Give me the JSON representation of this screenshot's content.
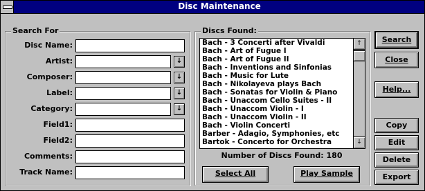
{
  "window": {
    "title": "Disc Maintenance"
  },
  "search_group": {
    "label": "Search For",
    "fields": [
      {
        "label": "Disc Name:",
        "value": "",
        "dropdown": false
      },
      {
        "label": "Artist:",
        "value": "",
        "dropdown": true
      },
      {
        "label": "Composer:",
        "value": "",
        "dropdown": true
      },
      {
        "label": "Label:",
        "value": "",
        "dropdown": true
      },
      {
        "label": "Category:",
        "value": "",
        "dropdown": true
      },
      {
        "label": "Field1:",
        "value": "",
        "dropdown": false
      },
      {
        "label": "Field2:",
        "value": "",
        "dropdown": false
      },
      {
        "label": "Comments:",
        "value": "",
        "dropdown": false
      },
      {
        "label": "Track Name:",
        "value": "",
        "dropdown": false
      }
    ]
  },
  "discs_group": {
    "label": "Discs Found:",
    "items": [
      "Bach - 3 Concerti after Vivaldi",
      "Bach - Art of Fugue I",
      "Bach - Art of Fugue II",
      "Bach - Inventions and Sinfonias",
      "Bach - Music for Lute",
      "Bach - Nikolayeva plays Bach",
      "Bach - Sonatas for Violin & Piano",
      "Bach - Unaccom Cello Suites - II",
      "Bach - Unaccom Violin - I",
      "Bach - Unaccom Violin - II",
      "Bach - Violin Concerti",
      "Barber - Adagio, Symphonies, etc",
      "Bartok - Concerto for Orchestra"
    ],
    "count_text": "Number of Discs Found: 180",
    "select_all_label": "Select All",
    "play_sample_label": "Play Sample"
  },
  "buttons": {
    "search": "Search",
    "close": "Close",
    "help": "Help...",
    "copy": "Copy",
    "edit": "Edit",
    "delete": "Delete",
    "export": "Export"
  },
  "icons": {
    "dropdown": "↓",
    "scroll_up": "↑",
    "scroll_down": "↓"
  }
}
